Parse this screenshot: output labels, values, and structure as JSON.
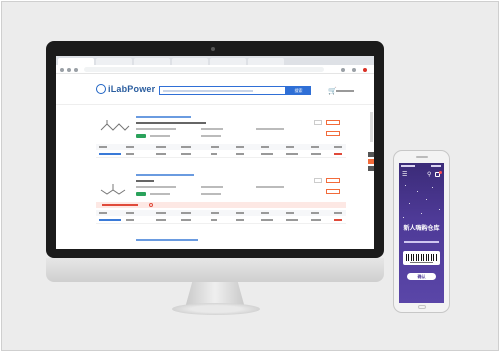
{
  "app": {
    "logo_text": "iLabPower",
    "search_button": "搜索"
  },
  "mobile": {
    "title": "新人嗨购仓库",
    "confirm": "确认"
  },
  "colors": {
    "brand_blue": "#2f6fd6",
    "accent_orange": "#f26b3a",
    "warning_red": "#e04a3a",
    "mobile_bg": "#4e3a97"
  },
  "icons": {
    "cart": "cart-icon",
    "menu": "menu-icon",
    "search": "search-icon",
    "bag": "bag-icon"
  }
}
